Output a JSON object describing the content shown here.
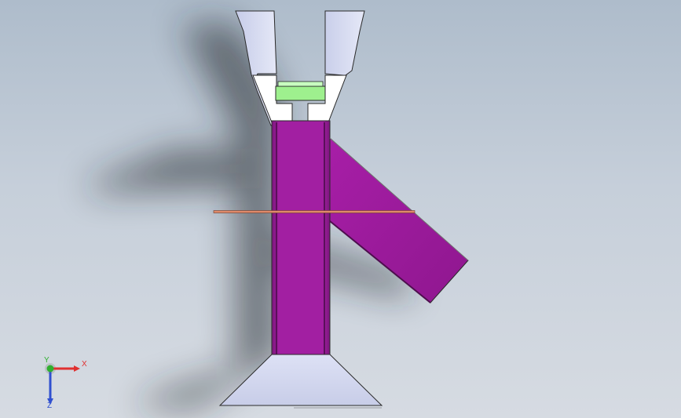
{
  "viewport": {
    "background_top": "#aebccb",
    "background_bottom": "#d6dbe2"
  },
  "model": {
    "parts": [
      "top-jaw-left",
      "top-jaw-right",
      "green-block",
      "vertical-post",
      "angled-arm",
      "thin-rod",
      "base-flange"
    ],
    "colors": {
      "jaw": "#cdd3f0",
      "green": "#9ef08e",
      "post": "#a020a0",
      "post_dark": "#6e0f6e",
      "rod": "#e08a6a",
      "base": "#c8cde8",
      "shadow": "#2b2f33"
    }
  },
  "triad": {
    "x_label": "X",
    "y_label": "Y",
    "z_label": "Z",
    "x_color": "#e03030",
    "y_color": "#30b030",
    "z_color": "#3050d0"
  }
}
